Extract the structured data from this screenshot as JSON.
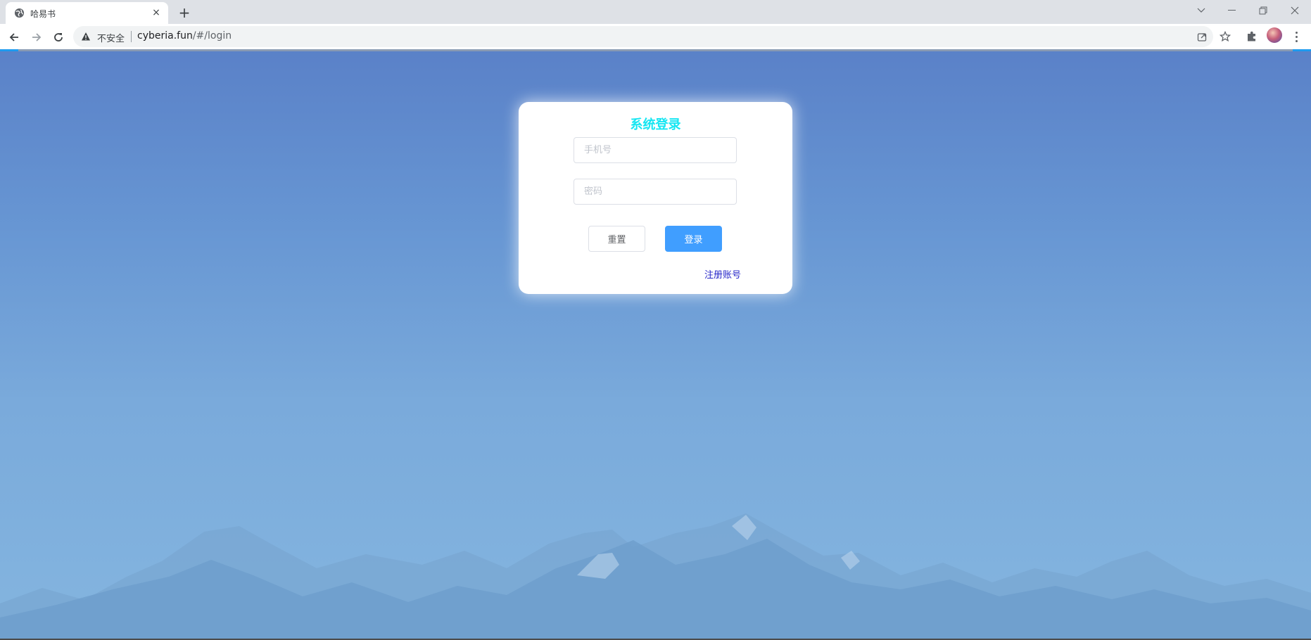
{
  "browser": {
    "tab": {
      "title": "哈易书",
      "favicon": "globe-icon",
      "close_label": "×"
    },
    "new_tab_label": "+",
    "window_controls": [
      "chevron-down-icon",
      "minimize-icon",
      "restore-icon",
      "close-icon"
    ],
    "security_label": "不安全",
    "url_host": "cyberia.fun",
    "url_path": "/#/login"
  },
  "login": {
    "title": "系统登录",
    "phone_placeholder": "手机号",
    "password_placeholder": "密码",
    "reset_label": "重置",
    "submit_label": "登录",
    "register_label": "注册账号"
  },
  "colors": {
    "title": "#16e6f2",
    "primary": "#409eff",
    "link": "#2626c8",
    "background_top": "#5a81c8",
    "background_bottom": "#84b5df"
  }
}
